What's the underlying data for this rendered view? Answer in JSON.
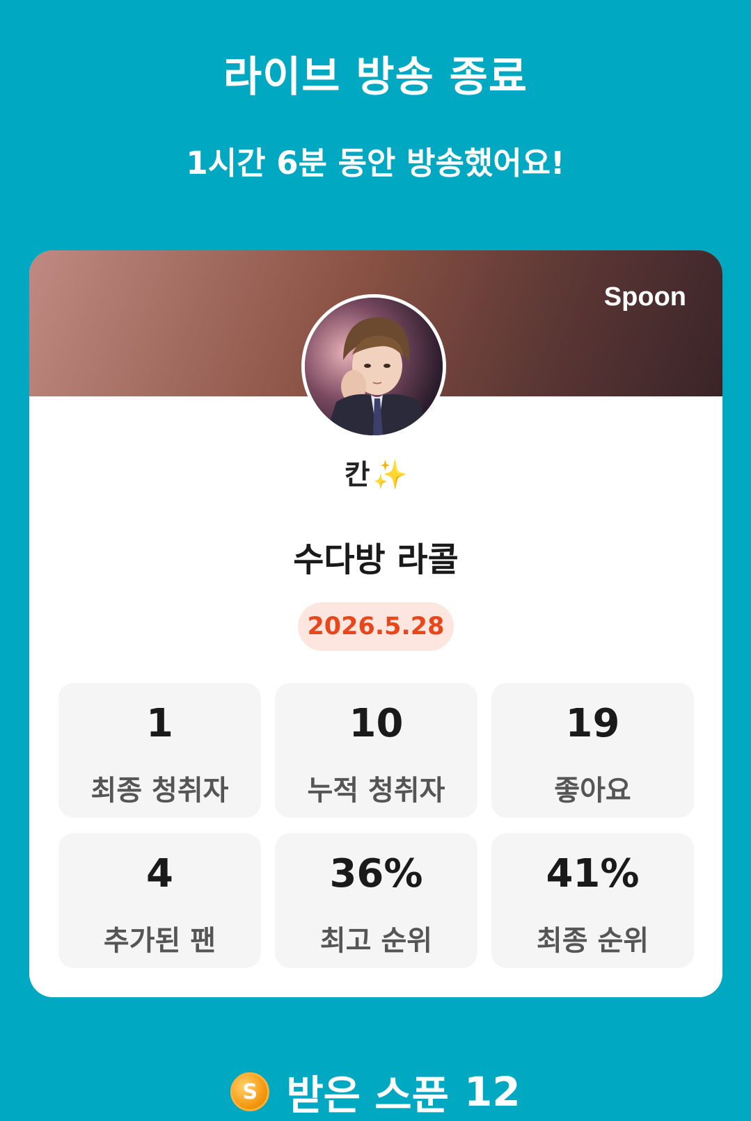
{
  "header": {
    "title": "라이브 방송 종료",
    "subtitle": "1시간 6분 동안 방송했어요!"
  },
  "card": {
    "brand": "Spoon",
    "nickname": "칸",
    "nickname_emoji": "✨",
    "room_title": "수다방 라콜",
    "date": "2026.5.28",
    "stats": [
      {
        "value": "1",
        "label": "최종 청취자"
      },
      {
        "value": "10",
        "label": "누적 청취자"
      },
      {
        "value": "19",
        "label": "좋아요"
      },
      {
        "value": "4",
        "label": "추가된 팬"
      },
      {
        "value": "36%",
        "label": "최고 순위"
      },
      {
        "value": "41%",
        "label": "최종 순위"
      }
    ]
  },
  "footer": {
    "coin_icon_letter": "S",
    "label": "받은 스푼",
    "amount": "12"
  },
  "colors": {
    "background": "#00a8c2",
    "date_text": "#e8461b",
    "date_bg": "#fde6df",
    "stat_bg": "#f5f5f5"
  }
}
